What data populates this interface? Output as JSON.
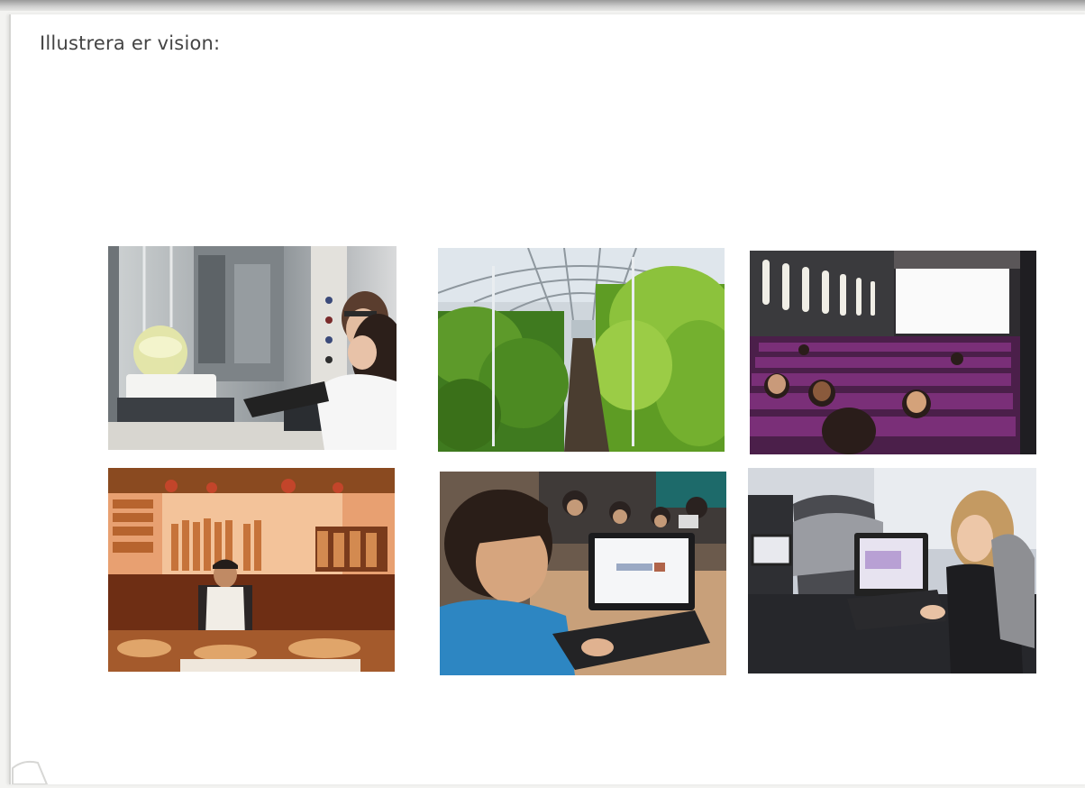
{
  "page": {
    "heading": "Illustrera er vision:"
  },
  "photos": [
    {
      "id": "laboratory",
      "subject": "researchers in a laboratory"
    },
    {
      "id": "greenhouse",
      "subject": "greenhouse with plants"
    },
    {
      "id": "lecture-hall",
      "subject": "lecture hall with projection screen"
    },
    {
      "id": "bakery",
      "subject": "bakery with bread shelves"
    },
    {
      "id": "student-laptop",
      "subject": "student working on laptop"
    },
    {
      "id": "train-laptop",
      "subject": "passengers with laptops on train"
    }
  ],
  "colors": {
    "heading": "#444444",
    "page_background": "#ffffff",
    "scan_edge": "#9a9a9a"
  }
}
